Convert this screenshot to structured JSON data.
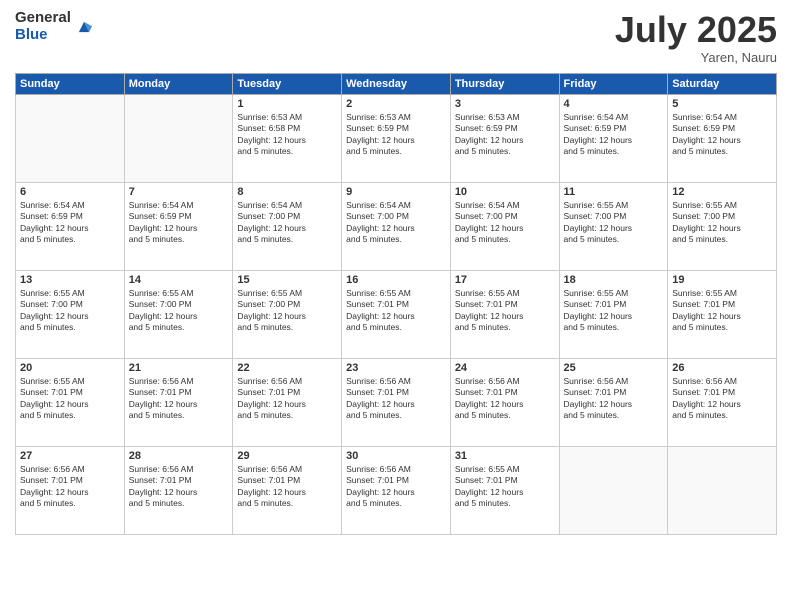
{
  "logo": {
    "general": "General",
    "blue": "Blue"
  },
  "title": "July 2025",
  "location": "Yaren, Nauru",
  "headers": [
    "Sunday",
    "Monday",
    "Tuesday",
    "Wednesday",
    "Thursday",
    "Friday",
    "Saturday"
  ],
  "weeks": [
    [
      {
        "day": "",
        "info": ""
      },
      {
        "day": "",
        "info": ""
      },
      {
        "day": "1",
        "info": "Sunrise: 6:53 AM\nSunset: 6:58 PM\nDaylight: 12 hours\nand 5 minutes."
      },
      {
        "day": "2",
        "info": "Sunrise: 6:53 AM\nSunset: 6:59 PM\nDaylight: 12 hours\nand 5 minutes."
      },
      {
        "day": "3",
        "info": "Sunrise: 6:53 AM\nSunset: 6:59 PM\nDaylight: 12 hours\nand 5 minutes."
      },
      {
        "day": "4",
        "info": "Sunrise: 6:54 AM\nSunset: 6:59 PM\nDaylight: 12 hours\nand 5 minutes."
      },
      {
        "day": "5",
        "info": "Sunrise: 6:54 AM\nSunset: 6:59 PM\nDaylight: 12 hours\nand 5 minutes."
      }
    ],
    [
      {
        "day": "6",
        "info": "Sunrise: 6:54 AM\nSunset: 6:59 PM\nDaylight: 12 hours\nand 5 minutes."
      },
      {
        "day": "7",
        "info": "Sunrise: 6:54 AM\nSunset: 6:59 PM\nDaylight: 12 hours\nand 5 minutes."
      },
      {
        "day": "8",
        "info": "Sunrise: 6:54 AM\nSunset: 7:00 PM\nDaylight: 12 hours\nand 5 minutes."
      },
      {
        "day": "9",
        "info": "Sunrise: 6:54 AM\nSunset: 7:00 PM\nDaylight: 12 hours\nand 5 minutes."
      },
      {
        "day": "10",
        "info": "Sunrise: 6:54 AM\nSunset: 7:00 PM\nDaylight: 12 hours\nand 5 minutes."
      },
      {
        "day": "11",
        "info": "Sunrise: 6:55 AM\nSunset: 7:00 PM\nDaylight: 12 hours\nand 5 minutes."
      },
      {
        "day": "12",
        "info": "Sunrise: 6:55 AM\nSunset: 7:00 PM\nDaylight: 12 hours\nand 5 minutes."
      }
    ],
    [
      {
        "day": "13",
        "info": "Sunrise: 6:55 AM\nSunset: 7:00 PM\nDaylight: 12 hours\nand 5 minutes."
      },
      {
        "day": "14",
        "info": "Sunrise: 6:55 AM\nSunset: 7:00 PM\nDaylight: 12 hours\nand 5 minutes."
      },
      {
        "day": "15",
        "info": "Sunrise: 6:55 AM\nSunset: 7:00 PM\nDaylight: 12 hours\nand 5 minutes."
      },
      {
        "day": "16",
        "info": "Sunrise: 6:55 AM\nSunset: 7:01 PM\nDaylight: 12 hours\nand 5 minutes."
      },
      {
        "day": "17",
        "info": "Sunrise: 6:55 AM\nSunset: 7:01 PM\nDaylight: 12 hours\nand 5 minutes."
      },
      {
        "day": "18",
        "info": "Sunrise: 6:55 AM\nSunset: 7:01 PM\nDaylight: 12 hours\nand 5 minutes."
      },
      {
        "day": "19",
        "info": "Sunrise: 6:55 AM\nSunset: 7:01 PM\nDaylight: 12 hours\nand 5 minutes."
      }
    ],
    [
      {
        "day": "20",
        "info": "Sunrise: 6:55 AM\nSunset: 7:01 PM\nDaylight: 12 hours\nand 5 minutes."
      },
      {
        "day": "21",
        "info": "Sunrise: 6:56 AM\nSunset: 7:01 PM\nDaylight: 12 hours\nand 5 minutes."
      },
      {
        "day": "22",
        "info": "Sunrise: 6:56 AM\nSunset: 7:01 PM\nDaylight: 12 hours\nand 5 minutes."
      },
      {
        "day": "23",
        "info": "Sunrise: 6:56 AM\nSunset: 7:01 PM\nDaylight: 12 hours\nand 5 minutes."
      },
      {
        "day": "24",
        "info": "Sunrise: 6:56 AM\nSunset: 7:01 PM\nDaylight: 12 hours\nand 5 minutes."
      },
      {
        "day": "25",
        "info": "Sunrise: 6:56 AM\nSunset: 7:01 PM\nDaylight: 12 hours\nand 5 minutes."
      },
      {
        "day": "26",
        "info": "Sunrise: 6:56 AM\nSunset: 7:01 PM\nDaylight: 12 hours\nand 5 minutes."
      }
    ],
    [
      {
        "day": "27",
        "info": "Sunrise: 6:56 AM\nSunset: 7:01 PM\nDaylight: 12 hours\nand 5 minutes."
      },
      {
        "day": "28",
        "info": "Sunrise: 6:56 AM\nSunset: 7:01 PM\nDaylight: 12 hours\nand 5 minutes."
      },
      {
        "day": "29",
        "info": "Sunrise: 6:56 AM\nSunset: 7:01 PM\nDaylight: 12 hours\nand 5 minutes."
      },
      {
        "day": "30",
        "info": "Sunrise: 6:56 AM\nSunset: 7:01 PM\nDaylight: 12 hours\nand 5 minutes."
      },
      {
        "day": "31",
        "info": "Sunrise: 6:55 AM\nSunset: 7:01 PM\nDaylight: 12 hours\nand 5 minutes."
      },
      {
        "day": "",
        "info": ""
      },
      {
        "day": "",
        "info": ""
      }
    ]
  ]
}
